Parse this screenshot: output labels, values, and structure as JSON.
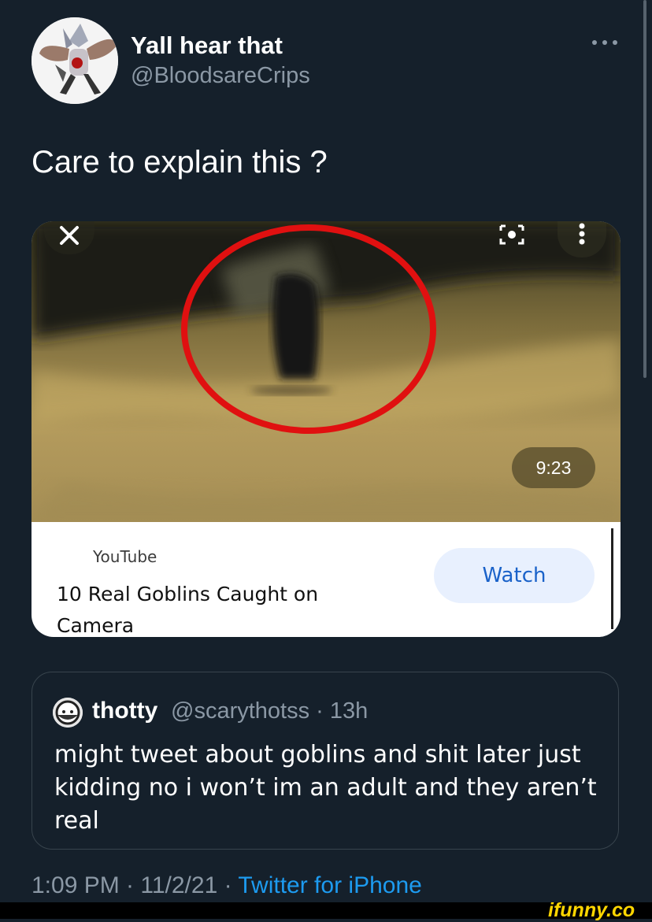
{
  "tweet": {
    "display_name": "Yall hear that",
    "handle": "@BloodsareCrips",
    "text": "Care to explain this ?",
    "more_icon": "more-horizontal-icon"
  },
  "card": {
    "duration": "9:23",
    "source": "YouTube",
    "title": "10 Real Goblins Caught on Camera",
    "watch_label": "Watch",
    "icons": [
      "close-icon",
      "cast-icon",
      "more-vertical-icon"
    ]
  },
  "quote": {
    "name": "thotty",
    "meta": "@scarythotss · 13h",
    "text": "might tweet about goblins and shit later just kidding no i won’t im an adult and they aren’t real"
  },
  "footer": {
    "time": "1:09 PM · 11/2/21 · ",
    "via": "Twitter for iPhone"
  },
  "watermark": "ifunny.co",
  "colors": {
    "background": "#15202b",
    "secondary_text": "#8b98a5",
    "link": "#1d9bf0",
    "watch_button_bg": "#e8f0fe",
    "watch_button_text": "#1a62c9",
    "highlight_circle": "#e01010"
  }
}
